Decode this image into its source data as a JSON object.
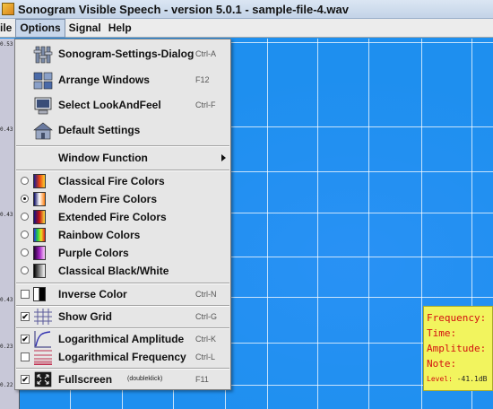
{
  "window": {
    "title": "Sonogram Visible Speech - version 5.0.1 - sample-file-4.wav"
  },
  "menubar": {
    "items": [
      {
        "label": "ile",
        "active": false
      },
      {
        "label": "Options",
        "active": true
      },
      {
        "label": "Signal",
        "active": false
      },
      {
        "label": "Help",
        "active": false
      }
    ]
  },
  "ruler": {
    "ticks": [
      "0.53",
      "0.43",
      "0.43",
      "0.43",
      "0.23",
      "0.22"
    ]
  },
  "options_menu": {
    "settings_dialog": {
      "label": "Sonogram-Settings-Dialog",
      "accel": "Ctrl-A"
    },
    "arrange_windows": {
      "label": "Arrange Windows",
      "accel": "F12"
    },
    "look_and_feel": {
      "label": "Select LookAndFeel",
      "accel": "Ctrl-F"
    },
    "default_settings": {
      "label": "Default Settings"
    },
    "window_function": {
      "label": "Window Function"
    },
    "color_schemes": [
      {
        "label": "Classical Fire Colors",
        "selected": false
      },
      {
        "label": "Modern Fire Colors",
        "selected": true
      },
      {
        "label": "Extended Fire Colors",
        "selected": false
      },
      {
        "label": "Rainbow Colors",
        "selected": false
      },
      {
        "label": "Purple Colors",
        "selected": false
      },
      {
        "label": "Classical Black/White",
        "selected": false
      }
    ],
    "inverse_color": {
      "label": "Inverse Color",
      "accel": "Ctrl-N",
      "checked": false
    },
    "show_grid": {
      "label": "Show Grid",
      "accel": "Ctrl-G",
      "checked": true
    },
    "log_amplitude": {
      "label": "Logarithmical Amplitude",
      "accel": "Ctrl-K",
      "checked": true
    },
    "log_frequency": {
      "label": "Logarithmical Frequency",
      "accel": "Ctrl-L",
      "checked": false
    },
    "fullscreen": {
      "label": "Fullscreen",
      "hint": "(doubleklick)",
      "accel": "F11",
      "checked": true
    }
  },
  "info_box": {
    "frequency": "Frequency:",
    "time": "Time:",
    "amplitude": "Amplitude:",
    "note": "Note:",
    "level_label": "Level:",
    "level_value": "-41.1dB"
  },
  "colors": {
    "spectrogram_bg": "#1e8fef",
    "info_bg": "#f2f45e",
    "info_text": "#d21010",
    "menu_bg": "#e6e6e6"
  }
}
